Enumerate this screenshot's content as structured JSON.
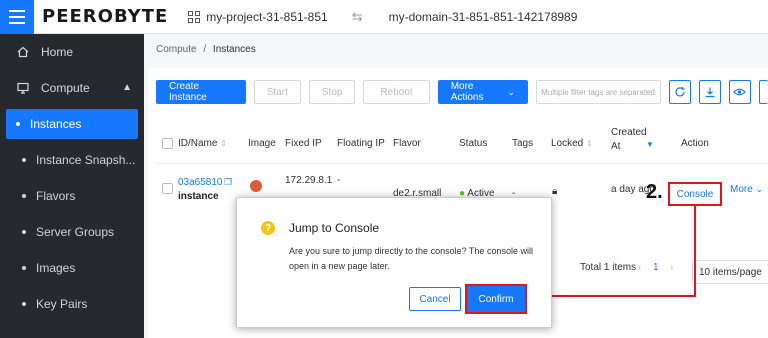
{
  "header": {
    "logo": "PEEROBYTE",
    "project": "my-project-31-851-851",
    "swap_glyph": "⇆",
    "domain": "my-domain-31-851-851-142178989"
  },
  "sidebar": {
    "items": [
      {
        "label": "Home",
        "icon": "home-icon"
      },
      {
        "label": "Compute",
        "icon": "monitor-icon"
      }
    ],
    "sub_items": [
      "Instances",
      "Instance Snapsh...",
      "Flavors",
      "Server Groups",
      "Images",
      "Key Pairs"
    ],
    "active": "Instances"
  },
  "breadcrumb": {
    "parent": "Compute",
    "sep": "/",
    "current": "Instances"
  },
  "toolbar": {
    "create": "Create Instance",
    "start": "Start",
    "stop": "Stop",
    "reboot": "Reboot",
    "more_actions": "More Actions",
    "filter_placeholder": "Multiple filter tags are separated"
  },
  "table": {
    "headers": {
      "id_name": "ID/Name",
      "image": "Image",
      "fixed_ip": "Fixed IP",
      "floating_ip": "Floating IP",
      "flavor": "Flavor",
      "status": "Status",
      "tags": "Tags",
      "locked": "Locked",
      "created_at": "Created At",
      "action": "Action"
    },
    "row": {
      "id": "03a65810",
      "name": "instance",
      "fixed_ip": "172.29.8.1",
      "floating_ip": "-",
      "flavor": "de2.r.small",
      "status": "Active",
      "tags": "-",
      "created": "a day ago",
      "console": "Console",
      "more": "More"
    },
    "total": "Total 1 items",
    "page": "1",
    "page_size": "10 items/page"
  },
  "modal": {
    "title": "Jump to Console",
    "body": "Are you sure to jump directly to the console? The console will open in a new page later.",
    "cancel": "Cancel",
    "confirm": "Confirm"
  },
  "annotation": {
    "step": "2."
  },
  "colors": {
    "primary": "#1677ff",
    "highlight": "#e4141c",
    "sidebar": "#26292e"
  }
}
